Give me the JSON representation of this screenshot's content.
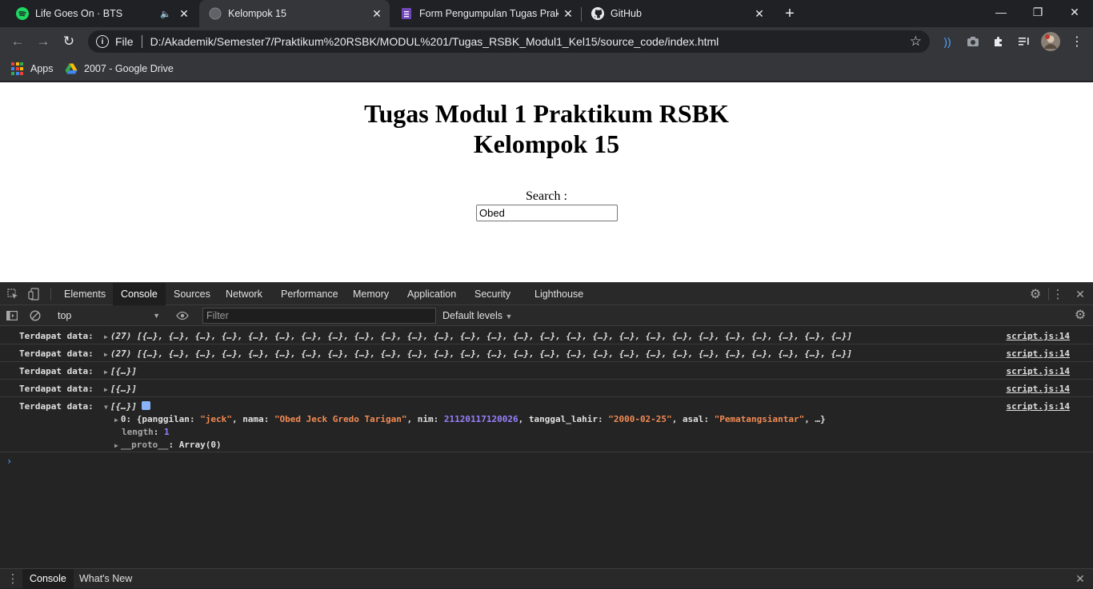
{
  "browser": {
    "tabs": [
      {
        "title": "Life Goes On · BTS",
        "icon": "spotify-icon",
        "audio": true
      },
      {
        "title": "Kelompok 15",
        "icon": "globe-icon",
        "active": true
      },
      {
        "title": "Form Pengumpulan Tugas Praktikum",
        "icon": "forms-icon"
      },
      {
        "title": "GitHub",
        "icon": "github-icon"
      }
    ],
    "address": {
      "scheme": "File",
      "url": "D:/Akademik/Semester7/Praktikum%20RSBK/MODUL%201/Tugas_RSBK_Modul1_Kel15/source_code/index.html"
    },
    "bookmarks": [
      {
        "label": "Apps",
        "icon": "apps-grid-icon"
      },
      {
        "label": "2007 - Google Drive",
        "icon": "google-drive-icon"
      }
    ]
  },
  "page": {
    "heading_line1": "Tugas Modul 1 Praktikum RSBK",
    "heading_line2": "Kelompok 15",
    "search_label": "Search :",
    "search_value": "Obed"
  },
  "devtools": {
    "tabs": [
      "Elements",
      "Console",
      "Sources",
      "Network",
      "Performance",
      "Memory",
      "Application",
      "Security",
      "Lighthouse"
    ],
    "active_tab": "Console",
    "context": "top",
    "filter_placeholder": "Filter",
    "levels": "Default levels",
    "console_rows": [
      {
        "prefix": "Terdapat data:",
        "value": "(27) [{…}, {…}, {…}, {…}, {…}, {…}, {…}, {…}, {…}, {…}, {…}, {…}, {…}, {…}, {…}, {…}, {…}, {…}, {…}, {…}, {…}, {…}, {…}, {…}, {…}, {…}, {…}]",
        "source": "script.js:14"
      },
      {
        "prefix": "Terdapat data:",
        "value": "(27) [{…}, {…}, {…}, {…}, {…}, {…}, {…}, {…}, {…}, {…}, {…}, {…}, {…}, {…}, {…}, {…}, {…}, {…}, {…}, {…}, {…}, {…}, {…}, {…}, {…}, {…}, {…}]",
        "source": "script.js:14"
      },
      {
        "prefix": "Terdapat data:",
        "value": "[{…}]",
        "source": "script.js:14"
      },
      {
        "prefix": "Terdapat data:",
        "value": "[{…}]",
        "source": "script.js:14"
      },
      {
        "prefix": "Terdapat data:",
        "value": "[{…}]",
        "source": "script.js:14",
        "expanded": true
      }
    ],
    "expanded": {
      "index": "0",
      "panggilan": "\"jeck\"",
      "nama": "\"Obed Jeck Gredo Tarigan\"",
      "nim": "21120117120026",
      "tanggal_lahir": "\"2000-02-25\"",
      "asal": "\"Pematangsiantar\"",
      "length_label": "length",
      "length_value": "1",
      "proto_label": "__proto__",
      "proto_value": "Array(0)"
    },
    "drawer_tabs": [
      "Console",
      "What's New"
    ]
  },
  "colors": {
    "chrome_dark": "#202124",
    "toolbar": "#35363a",
    "devtools_bg": "#242424",
    "string": "#f28b54",
    "number": "#9980ff"
  }
}
